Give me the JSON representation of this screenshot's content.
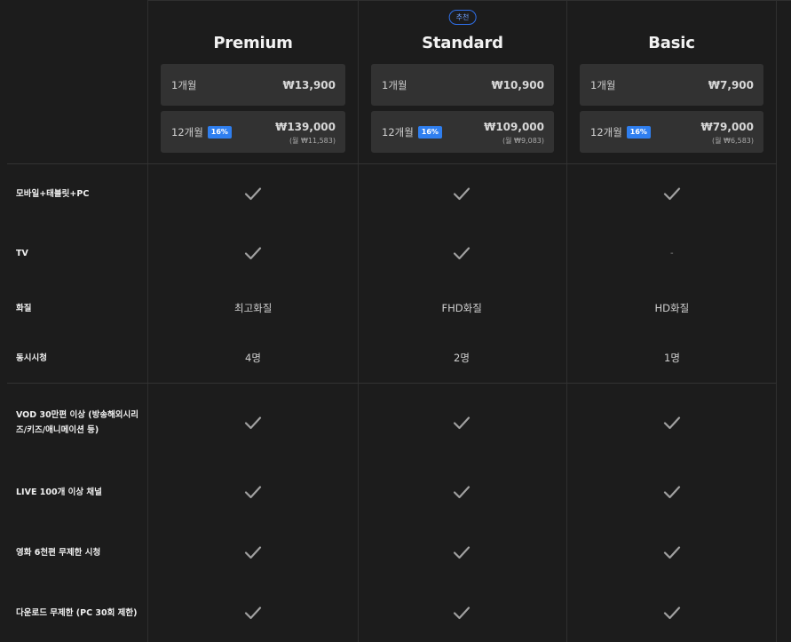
{
  "plans": [
    {
      "name": "Premium",
      "recommended": false,
      "monthly": {
        "period": "1개월",
        "price": "₩13,900"
      },
      "yearly": {
        "period": "12개월",
        "discount": "16%",
        "price": "₩139,000",
        "per_month": "(월 ₩11,583)"
      }
    },
    {
      "name": "Standard",
      "recommended": true,
      "recommended_label": "추천",
      "monthly": {
        "period": "1개월",
        "price": "₩10,900"
      },
      "yearly": {
        "period": "12개월",
        "discount": "16%",
        "price": "₩109,000",
        "per_month": "(월 ₩9,083)"
      }
    },
    {
      "name": "Basic",
      "recommended": false,
      "monthly": {
        "period": "1개월",
        "price": "₩7,900"
      },
      "yearly": {
        "period": "12개월",
        "discount": "16%",
        "price": "₩79,000",
        "per_month": "(월 ₩6,583)"
      }
    }
  ],
  "features": [
    {
      "label": "모바일+태블릿+PC",
      "values": [
        "check",
        "check",
        "check"
      ]
    },
    {
      "label": "TV",
      "values": [
        "check",
        "check",
        "-"
      ]
    },
    {
      "label": "화질",
      "values": [
        "최고화질",
        "FHD화질",
        "HD화질"
      ]
    },
    {
      "label": "동시시청",
      "values": [
        "4명",
        "2명",
        "1명"
      ]
    },
    {
      "label": "VOD 30만편 이상 (방송해외시리즈/키즈/애니메이션 등)",
      "values": [
        "check",
        "check",
        "check"
      ]
    },
    {
      "label": "LIVE 100개 이상 채널",
      "values": [
        "check",
        "check",
        "check"
      ]
    },
    {
      "label": "영화 6천편 무제한 시청",
      "values": [
        "check",
        "check",
        "check"
      ]
    },
    {
      "label": "다운로드 무제한 (PC 30회 제한)",
      "values": [
        "check",
        "check",
        "check"
      ]
    }
  ],
  "colors": {
    "background": "#1c1c1c",
    "price_box": "#323232",
    "accent": "#2f7ff0",
    "check": "#a0a0a0"
  }
}
